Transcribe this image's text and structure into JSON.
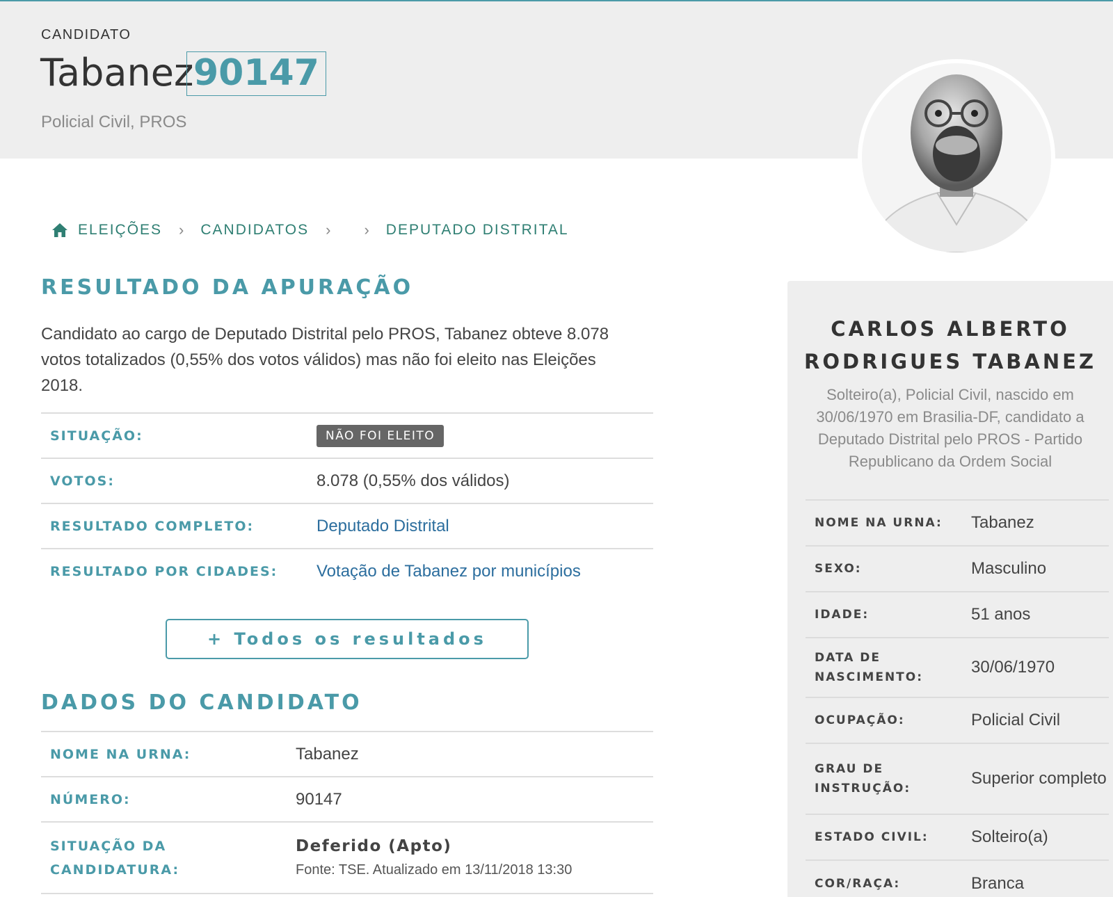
{
  "hero": {
    "label": "CANDIDATO",
    "name": "Tabanez",
    "number": "90147",
    "subtitle": "Policial Civil, PROS"
  },
  "breadcrumb": {
    "items": [
      "ELEIÇÕES",
      "CANDIDATOS",
      "",
      "DEPUTADO DISTRITAL"
    ],
    "home_icon": "home-icon"
  },
  "resultado": {
    "title": "RESULTADO DA APURAÇÃO",
    "intro": "Candidato ao cargo de Deputado Distrital pelo PROS, Tabanez obteve 8.078 votos totalizados (0,55% dos votos válidos) mas não foi eleito nas Eleições 2018.",
    "rows": {
      "situacao": {
        "label": "SITUAÇÃO:",
        "value": "NÃO FOI ELEITO"
      },
      "votos": {
        "label": "VOTOS:",
        "value": "8.078 (0,55% dos válidos)"
      },
      "completo": {
        "label": "RESULTADO COMPLETO:",
        "value": "Deputado Distrital"
      },
      "cidades": {
        "label": "RESULTADO POR CIDADES:",
        "value": "Votação de Tabanez por municípios"
      }
    },
    "button": "+ Todos os resultados"
  },
  "dados": {
    "title": "DADOS DO CANDIDATO",
    "rows": {
      "nome_urna": {
        "label": "NOME NA URNA:",
        "value": "Tabanez"
      },
      "numero": {
        "label": "NÚMERO:",
        "value": "90147"
      },
      "situacao": {
        "label1": "SITUAÇÃO DA",
        "label2": "CANDIDATURA:",
        "value": "Deferido (Apto)",
        "note": "Fonte: TSE. Atualizado em 13/11/2018 13:30"
      }
    }
  },
  "side": {
    "name_line1": "CARLOS ALBERTO",
    "name_line2": "RODRIGUES TABANEZ",
    "description": "Solteiro(a), Policial Civil, nascido em 30/06/1970 em Brasilia-DF, candidato a Deputado Distrital pelo PROS - Partido Republicano da Ordem Social",
    "rows": [
      {
        "k1": "NOME NA URNA:",
        "k2": "",
        "v": "Tabanez"
      },
      {
        "k1": "SEXO:",
        "k2": "",
        "v": "Masculino"
      },
      {
        "k1": "IDADE:",
        "k2": "",
        "v": "51 anos"
      },
      {
        "k1": "DATA DE",
        "k2": "NASCIMENTO:",
        "v": "30/06/1970"
      },
      {
        "k1": "OCUPAÇÃO:",
        "k2": "",
        "v": "Policial Civil"
      },
      {
        "k1": "GRAU DE",
        "k2": "INSTRUÇÃO:",
        "v": "Superior completo"
      },
      {
        "k1": "ESTADO CIVIL:",
        "k2": "",
        "v": "Solteiro(a)"
      },
      {
        "k1": "COR/RAÇA:",
        "k2": "",
        "v": "Branca"
      }
    ]
  },
  "colors": {
    "accent": "#4a9aa8",
    "breadcrumb": "#2f7f73",
    "link": "#2c6e9e",
    "badge": "#666666",
    "hero_bg": "#eeeeee"
  }
}
